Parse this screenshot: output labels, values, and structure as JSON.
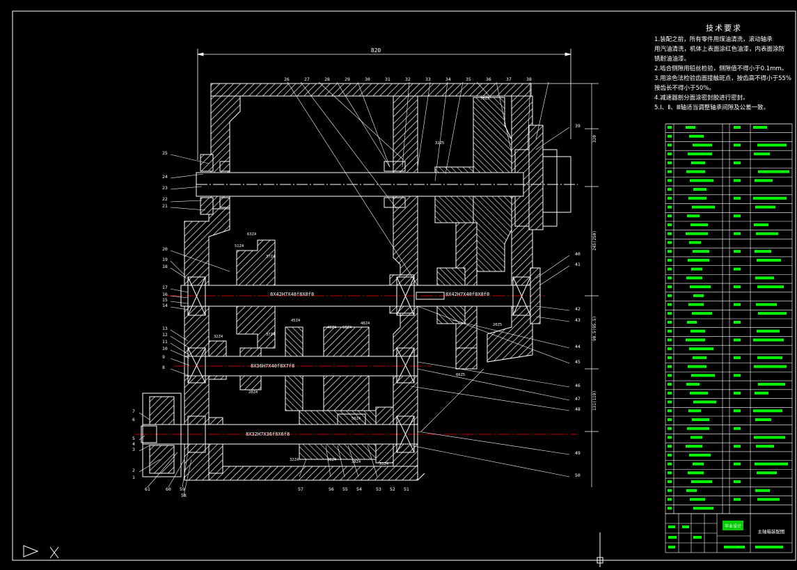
{
  "drawing": {
    "notes": {
      "title": "技术要求",
      "lines": [
        "1.装配之前，所有零件用煤油清洗，滚动轴承",
        "用汽油清洗，机体上表面涂红色油漆，内表面涂防",
        "锈耐油油漆。",
        "2.啮合侧隙用铅丝检验，侧隙值不得小于0.1mm。",
        "3.用涂色法检验齿面接触斑点，按齿高不得小于55%",
        "按齿长不得小于50%。",
        "4.减速器剖分面涂密封胶进行密封。",
        "5.Ⅰ、Ⅱ、Ⅲ轴适当调整轴承间隙及公差一致。"
      ]
    },
    "dims": {
      "overall_width": "820"
    },
    "shafts": [
      {
        "label": "8X42H7X48f8X8f8"
      },
      {
        "label": "8X42H7X48f8X8f8"
      },
      {
        "label": "8X36H7X40f8X7f8"
      },
      {
        "label": "8X32H7X36f8X6f8"
      }
    ],
    "gear_labels": [
      "63Z4",
      "51Z4",
      "37Z4",
      "37Z4",
      "32Z4",
      "20Z4",
      "45Z4",
      "40Z4",
      "48Z4",
      "60Z4",
      "20Z5",
      "66Z5",
      "32Z4",
      "50Z4",
      "38Z4",
      "31Z4",
      "56Z4",
      "75Z5",
      "32Z5"
    ],
    "balloons_left": [
      "25",
      "24",
      "23",
      "22",
      "21",
      "20",
      "19",
      "18",
      "17",
      "16",
      "15",
      "14",
      "13",
      "12",
      "11",
      "10",
      "9",
      "8",
      "7",
      "6",
      "5",
      "4",
      "3",
      "2",
      "1"
    ],
    "balloons_top": [
      "26",
      "27",
      "28",
      "29",
      "30",
      "31",
      "32",
      "33",
      "34",
      "35",
      "36",
      "37",
      "38"
    ],
    "balloons_right": [
      "39",
      "40",
      "41",
      "42",
      "43",
      "44",
      "45",
      "46",
      "47",
      "48",
      "49",
      "50"
    ],
    "balloons_bottom": [
      "61",
      "60",
      "59",
      "58",
      "57",
      "56",
      "55",
      "54",
      "53",
      "52",
      "51"
    ],
    "title_block": {
      "drawing_name": "主轴箱装配图",
      "stamp": "毕业设计"
    },
    "colors": {
      "bg": "#000000",
      "line": "#ffffff",
      "section": "#ffffff",
      "center": "#ff0000",
      "table": "#00ff00",
      "leader": "#ffffff"
    }
  }
}
